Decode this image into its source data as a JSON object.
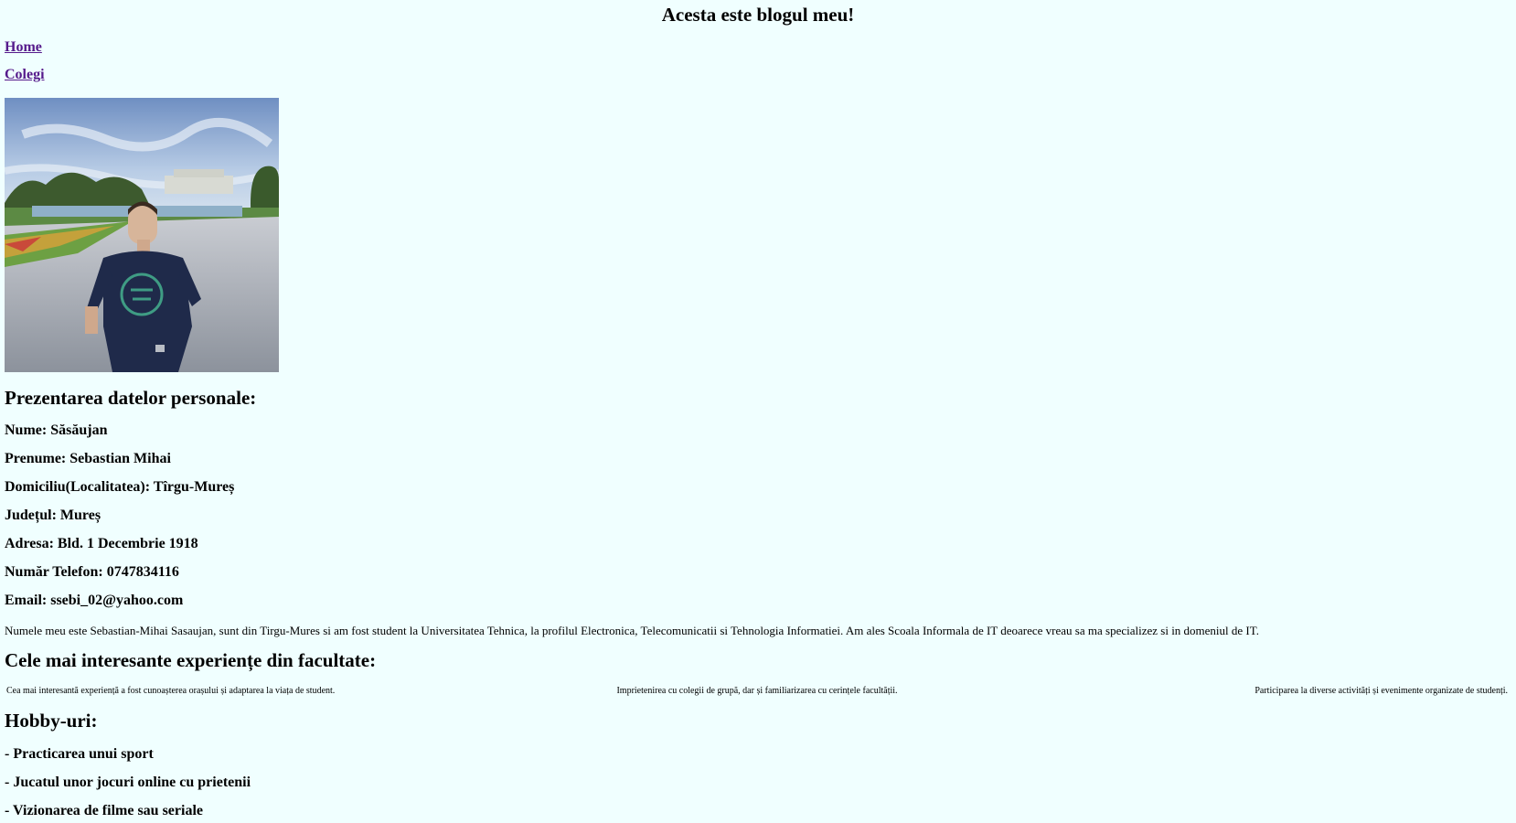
{
  "header": {
    "title": "Acesta este blogul meu!"
  },
  "nav": {
    "home": "Home",
    "colegi": "Colegi"
  },
  "profile_photo": {
    "icon": "profile-photo"
  },
  "personal": {
    "heading": "Prezentarea datelor personale:",
    "nume": "Nume: Săsăujan",
    "prenume": "Prenume: Sebastian Mihai",
    "domiciliu": "Domiciliu(Localitatea): Tîrgu-Mureș",
    "judet": "Județul: Mureș",
    "adresa": "Adresa: Bld. 1 Decembrie 1918",
    "telefon": "Număr Telefon: 0747834116",
    "email": "Email: ssebi_02@yahoo.com",
    "bio": "Numele meu este Sebastian-Mihai Sasaujan, sunt din Tirgu-Mures si am fost student la Universitatea Tehnica, la profilul Electronica, Telecomunicatii si Tehnologia Informatiei. Am ales Scoala Informala de IT deoarece vreau sa ma specializez si in domeniul de IT."
  },
  "experiences": {
    "heading": "Cele mai interesante experiențe din facultate:",
    "items": [
      "Cea mai interesantă experiență a fost cunoașterea orașului și adaptarea la viața de student.",
      "Imprietenirea cu colegii de grupă, dar și familiarizarea cu cerințele facultății.",
      "Participarea la diverse activități și evenimente organizate de studenți."
    ]
  },
  "hobbies": {
    "heading": "Hobby-uri:",
    "items": [
      "- Practicarea unui sport",
      "- Jucatul unor jocuri online cu prietenii",
      "- Vizionarea de filme sau seriale"
    ]
  }
}
